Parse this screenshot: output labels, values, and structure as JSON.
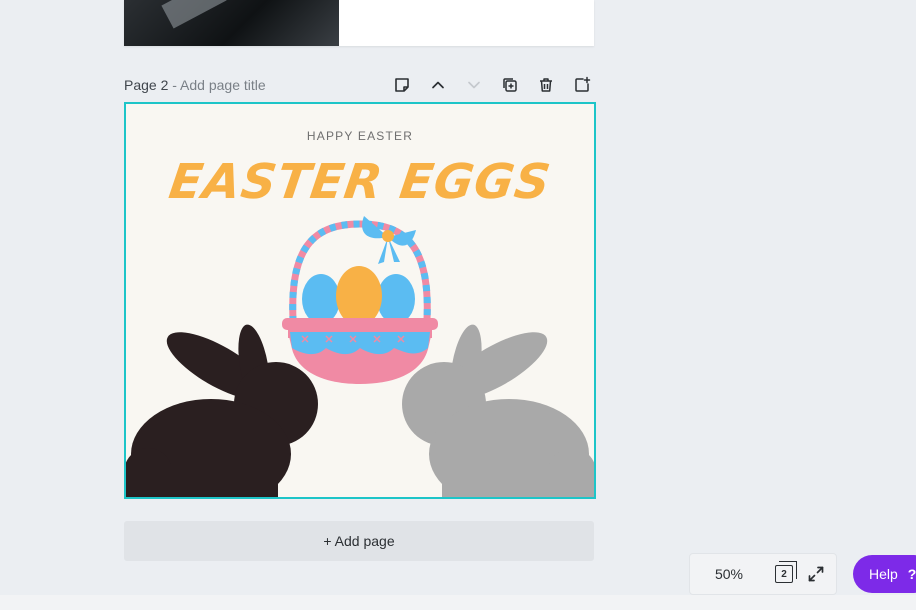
{
  "page": {
    "label": "Page 2",
    "separator": " - ",
    "title_placeholder": "Add page title"
  },
  "toolbar_icons": [
    "notes-icon",
    "chevron-up-icon",
    "chevron-down-icon",
    "duplicate-icon",
    "trash-icon",
    "add-page-icon"
  ],
  "design": {
    "subtitle": "HAPPY EASTER",
    "title": "EASTER EGGS",
    "colors": {
      "title": "#f8b146",
      "background": "#f9f7f2",
      "selection_border": "#1dc5c8",
      "egg_blue": "#5bbcf2",
      "egg_orange": "#f8b146",
      "basket_pink": "#f08aa4",
      "bunny_dark": "#2a1f20",
      "bunny_gray": "#a9a9a9"
    }
  },
  "add_page_label": "+ Add page",
  "zoom": {
    "value": "50%",
    "page_count": "2"
  },
  "help": {
    "label": "Help",
    "icon": "?"
  }
}
